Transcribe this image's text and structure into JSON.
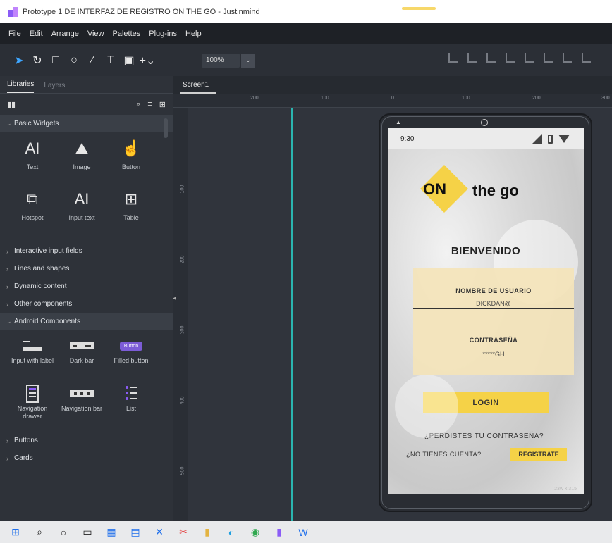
{
  "window": {
    "title": "Prototype 1 DE INTERFAZ DE REGISTRO ON THE GO - Justinmind"
  },
  "menu": [
    "File",
    "Edit",
    "Arrange",
    "View",
    "Palettes",
    "Plug-ins",
    "Help"
  ],
  "toolbar": {
    "tools": [
      {
        "icon": "select-arrow-icon",
        "glyph": "➤"
      },
      {
        "icon": "lasso-icon",
        "glyph": "↻"
      },
      {
        "icon": "rectangle-icon",
        "glyph": "□"
      },
      {
        "icon": "ellipse-icon",
        "glyph": "○"
      },
      {
        "icon": "line-icon",
        "glyph": "∕"
      },
      {
        "icon": "text-icon",
        "glyph": "T"
      },
      {
        "icon": "image-icon",
        "glyph": "▣"
      },
      {
        "icon": "add-icon",
        "glyph": "+⌄"
      }
    ],
    "zoom": "100%",
    "zoom_dropdown_glyph": "⌄"
  },
  "left_panel": {
    "tabs": [
      "Libraries",
      "Layers"
    ],
    "section_basic": "Basic Widgets",
    "basic_widgets": [
      {
        "label": "Text",
        "icon": "text-widget-icon",
        "glyph": "AI"
      },
      {
        "label": "Image",
        "icon": "image-widget-icon",
        "glyph": "⛰"
      },
      {
        "label": "Button",
        "icon": "button-widget-icon",
        "glyph": "☝"
      },
      {
        "label": "Hotspot",
        "icon": "hotspot-widget-icon",
        "glyph": "⧉"
      },
      {
        "label": "Input text",
        "icon": "input-text-widget-icon",
        "glyph": "AI"
      },
      {
        "label": "Table",
        "icon": "table-widget-icon",
        "glyph": "⊞"
      }
    ],
    "collapsed_sections": [
      "Interactive input fields",
      "Lines and shapes",
      "Dynamic content",
      "Other components"
    ],
    "section_android": "Android Components",
    "android_widgets": [
      {
        "label": "Input with label",
        "icon": "input-with-label-icon"
      },
      {
        "label": "Dark bar",
        "icon": "dark-bar-icon"
      },
      {
        "label": "Filled button",
        "icon": "filled-button-icon",
        "badge": "Button"
      },
      {
        "label": "Navigation drawer",
        "icon": "navigation-drawer-icon"
      },
      {
        "label": "Navigation bar",
        "icon": "navigation-bar-icon"
      },
      {
        "label": "List",
        "icon": "list-icon"
      }
    ],
    "bottom_sections": [
      "Buttons",
      "Cards"
    ]
  },
  "canvas": {
    "tab": "Screen1",
    "ruler_top": [
      "200",
      "100",
      "0",
      "100",
      "200",
      "300"
    ],
    "ruler_left": [
      "100",
      "200",
      "300",
      "400",
      "500"
    ]
  },
  "phone": {
    "status_time": "9:30",
    "logo_on": "ON",
    "logo_rest": "the go",
    "welcome": "BIENVENIDO",
    "username_label": "NOMBRE DE USUARIO",
    "username_value": "DICKDAN@",
    "password_label": "CONTRASEÑA",
    "password_value": "*****GH",
    "login_button": "LOGIN",
    "forgot_password": "¿PERDISTES TU CONTRASEÑA?",
    "no_account": "¿NO TIENES CUENTA?",
    "register_button": "REGISTRATE",
    "size_badge": "23w x 315"
  },
  "taskbar": [
    {
      "icon": "windows-start-icon",
      "glyph": "⊞",
      "color": "#1f6feb"
    },
    {
      "icon": "search-icon",
      "glyph": "⌕",
      "color": "#222222"
    },
    {
      "icon": "cortana-icon",
      "glyph": "○",
      "color": "#222222"
    },
    {
      "icon": "task-view-icon",
      "glyph": "▭",
      "color": "#222222"
    },
    {
      "icon": "calendar-icon",
      "glyph": "▦",
      "color": "#1f6feb"
    },
    {
      "icon": "store-icon",
      "glyph": "▤",
      "color": "#1f6feb"
    },
    {
      "icon": "vscode-icon",
      "glyph": "✕",
      "color": "#1f6feb"
    },
    {
      "icon": "snip-icon",
      "glyph": "✂",
      "color": "#e34b4b"
    },
    {
      "icon": "folder-icon",
      "glyph": "▮",
      "color": "#e3b341"
    },
    {
      "icon": "edge-icon",
      "glyph": "◐",
      "color": "#1f9fe0"
    },
    {
      "icon": "chrome-icon",
      "glyph": "◉",
      "color": "#2fa84f"
    },
    {
      "icon": "justinmind-icon",
      "glyph": "▮",
      "color": "#8b5cf6"
    },
    {
      "icon": "word-icon",
      "glyph": "W",
      "color": "#1f6feb"
    }
  ],
  "colors": {
    "accent_yellow": "#f5d247",
    "guide_teal": "#2bb5b0",
    "form_card": "#f4e4ba"
  }
}
